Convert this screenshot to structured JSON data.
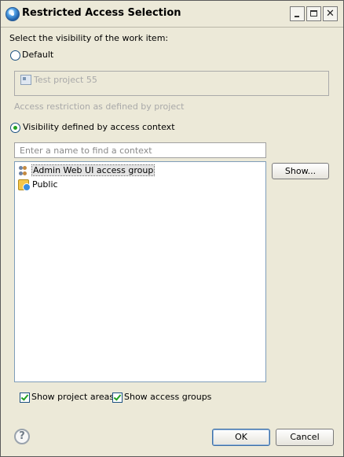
{
  "window": {
    "title": "Restricted Access Selection"
  },
  "titlebar_buttons": {
    "minimize": "",
    "maximize": "",
    "close": "✕"
  },
  "form": {
    "visibility_prompt": "Select the visibility of the work item:",
    "option_default": "Default",
    "default_project": "Test project 55",
    "project_restriction_note": "Access restriction as defined by project",
    "option_access_context": "Visibility defined by access context",
    "selected_option": "access_context"
  },
  "search": {
    "placeholder": "Enter a name to find a context",
    "value": ""
  },
  "contexts": {
    "items": [
      {
        "label": "Admin Web UI access group",
        "icon": "access-group-icon",
        "selected": true
      },
      {
        "label": "Public",
        "icon": "public-icon",
        "selected": false
      }
    ]
  },
  "buttons": {
    "show": "Show...",
    "ok": "OK",
    "cancel": "Cancel"
  },
  "filters": {
    "show_project_areas": {
      "label": "Show project areas",
      "checked": true
    },
    "show_access_groups": {
      "label": "Show access groups",
      "checked": true
    }
  },
  "help": {
    "glyph": "?"
  }
}
